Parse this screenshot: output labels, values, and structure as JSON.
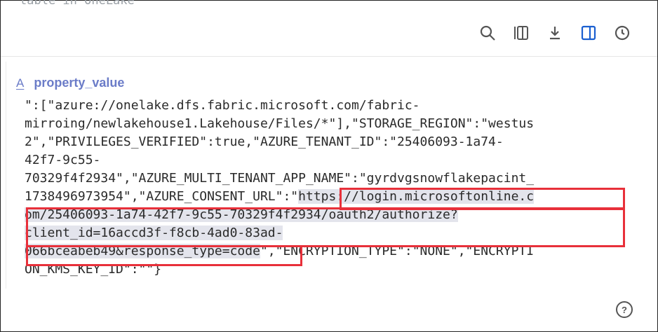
{
  "top_caption": "table in OneLake",
  "toolbar": {
    "icons": [
      "search-icon",
      "columns-icon",
      "download-icon",
      "side-panel-icon",
      "history-icon"
    ],
    "accent": "#1a5fd0"
  },
  "column": {
    "type_glyph": "A",
    "name": "property_value"
  },
  "value_lines": {
    "l0": "\":[\"azure://onelake.dfs.fabric.microsoft.com/fabric-",
    "l1": "mirroing/newlakehouse1.Lakehouse/Files/*\"],\"STORAGE_REGION\":\"westus",
    "l2": "2\",\"PRIVILEGES_VERIFIED\":true,\"AZURE_TENANT_ID\":\"25406093-1a74-",
    "l3": "42f7-9c55-",
    "l4": "70329f4f2934\",\"AZURE_MULTI_TENANT_APP_NAME\":\"gyrdvgsnowflakepacint_",
    "l5_pre": "1738496973954\",\"AZURE_CONSENT_URL\":\"",
    "l5_hl": "https://login.microsoftonline.c",
    "l6_hl": "om/25406093-1a74-42f7-9c55-70329f4f2934/oauth2/authorize?",
    "l7_hl": "client_id=16accd3f-f8cb-4ad0-83ad-",
    "l8_hl": "066bceabeb49&response_type=code",
    "l8_post": "\",\"ENCRYPTION_TYPE\":\"NONE\",\"ENCRYPTI",
    "l9": "ON_KMS_KEY_ID\":\"\"}"
  },
  "highlight_color": "#e8303a",
  "help_label": "?"
}
